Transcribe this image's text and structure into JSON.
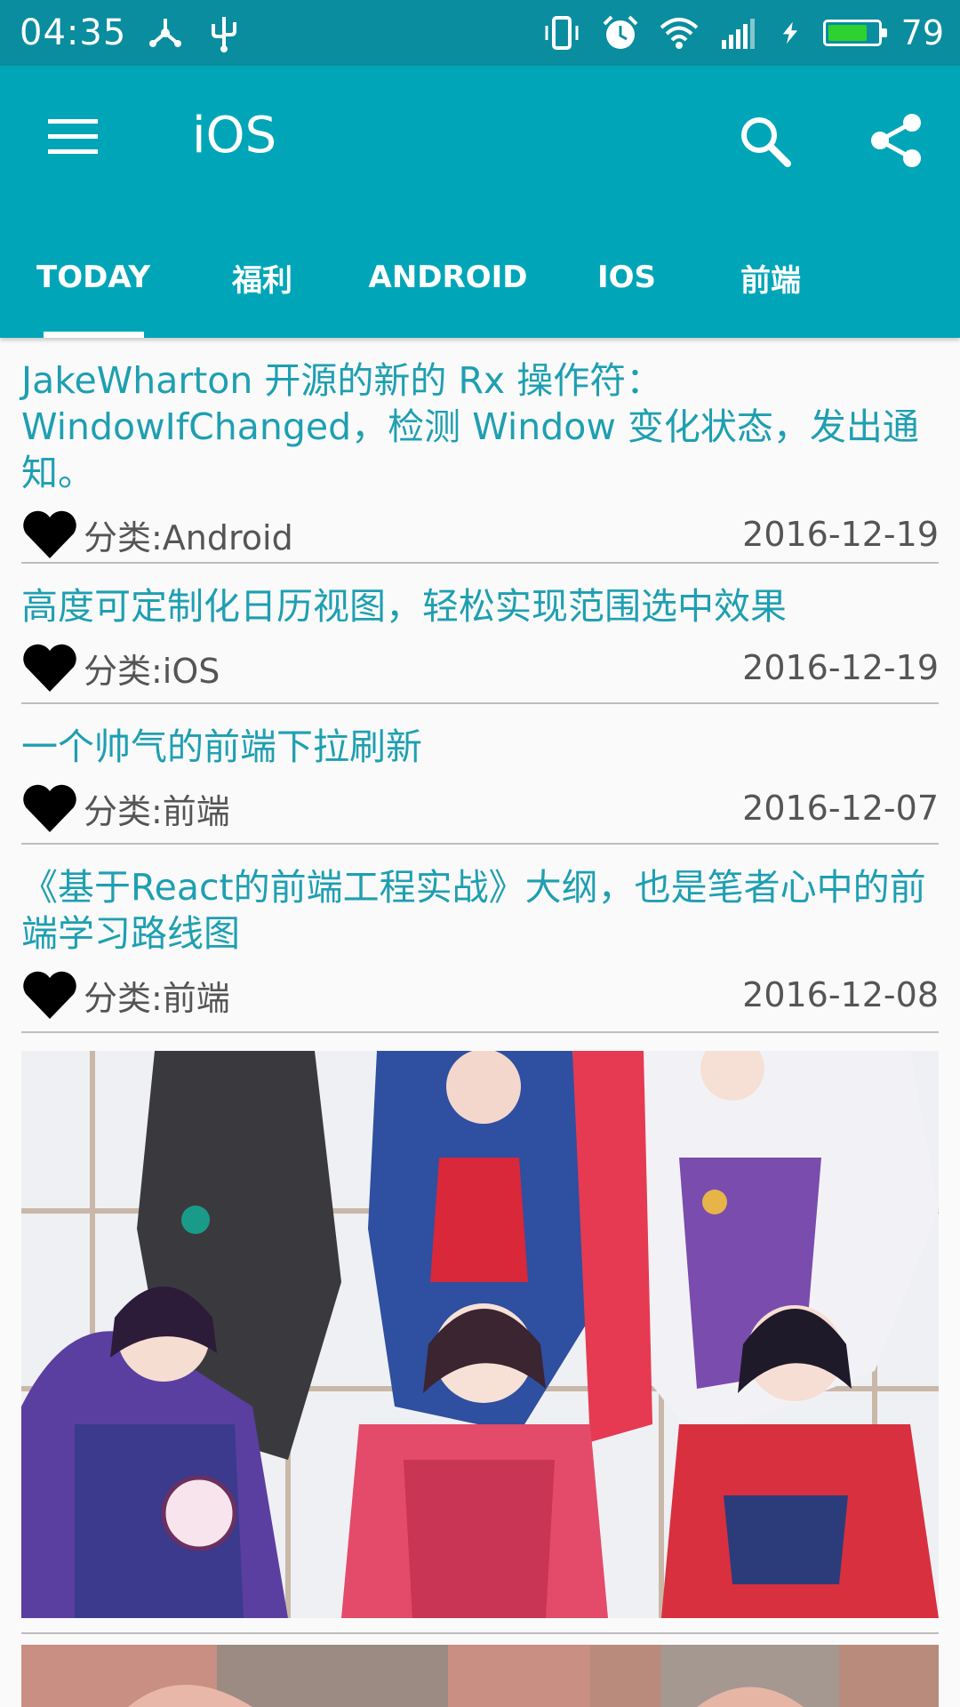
{
  "status_bar": {
    "time": "04:35",
    "battery_level": "79",
    "battery_fraction": 0.79,
    "icons": [
      "share-network-icon",
      "usb-icon",
      "vibrate-icon",
      "alarm-icon",
      "wifi-icon",
      "cell-signal-4g-icon",
      "charging-icon",
      "battery-icon"
    ]
  },
  "app_bar": {
    "title": "iOS",
    "menu_icon": "menu-icon",
    "search_icon": "search-icon",
    "share_icon": "share-icon"
  },
  "tabs": [
    {
      "label": "TODAY",
      "selected": true
    },
    {
      "label": "福利",
      "selected": false
    },
    {
      "label": "ANDROID",
      "selected": false
    },
    {
      "label": "IOS",
      "selected": false
    },
    {
      "label": "前端",
      "selected": false
    }
  ],
  "items": [
    {
      "title": "JakeWharton 开源的新的 Rx 操作符：WindowIfChanged，检测 Window 变化状态，发出通知。",
      "category": "分类:Android",
      "date": "2016-12-19"
    },
    {
      "title": "高度可定制化日历视图，轻松实现范围选中效果",
      "category": "分类:iOS",
      "date": "2016-12-19"
    },
    {
      "title": "一个帅气的前端下拉刷新",
      "category": "分类:前端",
      "date": "2016-12-07"
    },
    {
      "title": "《基于React的前端工程实战》大纲，也是笔者心中的前端学习路线图",
      "category": "分类:前端",
      "date": "2016-12-08"
    }
  ],
  "colors": {
    "primary": "#00a6b8",
    "status_bar": "#0a8d9e",
    "title_text": "#1e9fb1",
    "meta_text": "#555555",
    "battery_green": "#2ed12e"
  }
}
